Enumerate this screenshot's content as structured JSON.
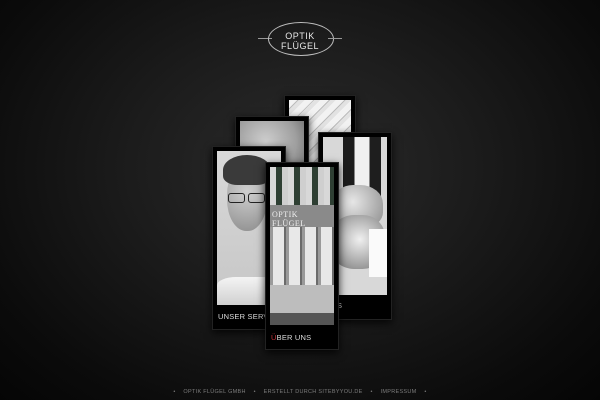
{
  "logo": {
    "text": "OPTIK FLÜGEL"
  },
  "cards": {
    "back_top": {
      "image": "window-blinds-photo"
    },
    "back_left": {
      "image": "gray-texture-photo"
    },
    "left": {
      "label": "UNSER SERVICE",
      "image": "portrait-man-glasses-photo"
    },
    "right": {
      "label_visible": "S",
      "image": "stacked-hands-photo"
    },
    "front": {
      "label_first": "Ü",
      "label_rest": "BER UNS",
      "sign_text": "OPTIK FLÜGEL",
      "image": "storefront-photo"
    }
  },
  "footer": {
    "items": [
      "OPTIK FLÜGEL GMBH",
      "ERSTELLT DURCH SITEBYYOU.DE",
      "IMPRESSUM"
    ],
    "separator": "•"
  }
}
